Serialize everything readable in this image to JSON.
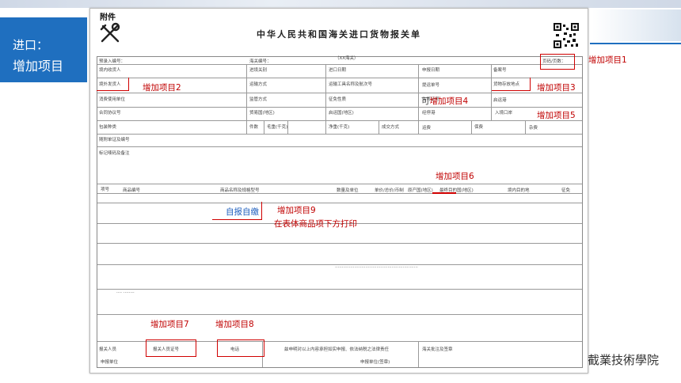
{
  "side_panel": {
    "line1": "进口：",
    "line2": "增加项目"
  },
  "school_name": "截業技術學院",
  "document": {
    "attachment_label": "附件",
    "title": "中华人民共和国海关进口货物报关单",
    "fields": {
      "pre_entry_no": "预录入编号：",
      "customs_no": "海关编号：",
      "customs_name": "（XX海关）",
      "page_no": "页码/页数：",
      "domestic_consignee": "境内收货人",
      "entry_port": "进境关别",
      "import_date": "进口日期",
      "declare_date": "申报日期",
      "record_no": "备案号",
      "overseas_shipper": "境外发货人",
      "transport_mode": "运输方式",
      "transport_name": "运输工具名称及航次号",
      "bill_no": "提运单号",
      "goods_place": "货物存放地点",
      "consumer_unit": "消费使用单位",
      "supervision_mode": "监管方式",
      "levy_nature": "征免性质",
      "license_no": "许可证号",
      "departure_port": "启运港",
      "contract_no": "合同协议号",
      "trade_country": "贸易国(地区)",
      "departure_country": "启运国(地区)",
      "transit_port": "经停港",
      "entry_point": "入境口岸",
      "package_type": "包装种类",
      "pieces": "件数",
      "gross_weight": "毛重(千克)",
      "net_weight": "净重(千克)",
      "deal_mode": "成交方式",
      "freight": "运费",
      "insurance": "保费",
      "misc_fee": "杂费",
      "attached_docs": "随附单证及编号",
      "marks_notes": "标记唛码及备注",
      "col_no": "项号",
      "col_code": "商品编号",
      "col_name": "商品名称及规格型号",
      "col_qty": "数量及单位",
      "col_price": "单价/总价/币制",
      "col_origin": "原产国(地区)",
      "col_dest_country": "最终目的国(地区)",
      "col_domestic_dest": "境内目的地",
      "col_levy": "征免",
      "declarer": "报关人员",
      "declarer_cert": "报关人员证号",
      "phone": "电话",
      "statement": "兹申明对以上内容承担如实申报、依法纳税之法律责任",
      "customs_note": "海关批注及签章",
      "declare_unit": "申报单位",
      "declare_unit_seal": "申报单位(签章)",
      "self_report": "自报自缴"
    }
  },
  "annotations": {
    "item1": "增加项目1",
    "item2": "增加项目2",
    "item3": "增加项目3",
    "item4_prefix": "可",
    "item4": "增加项目4",
    "item5": "增加项目5",
    "item6": "增加项目6",
    "item7": "增加项目7",
    "item8": "增加项目8",
    "item9": "增加项目9",
    "item9_note": "在表体商品项下方打印"
  },
  "colors": {
    "panel_blue": "#1f6fbf",
    "annotation_red": "#c00000",
    "self_report_blue": "#1f5fbf"
  }
}
